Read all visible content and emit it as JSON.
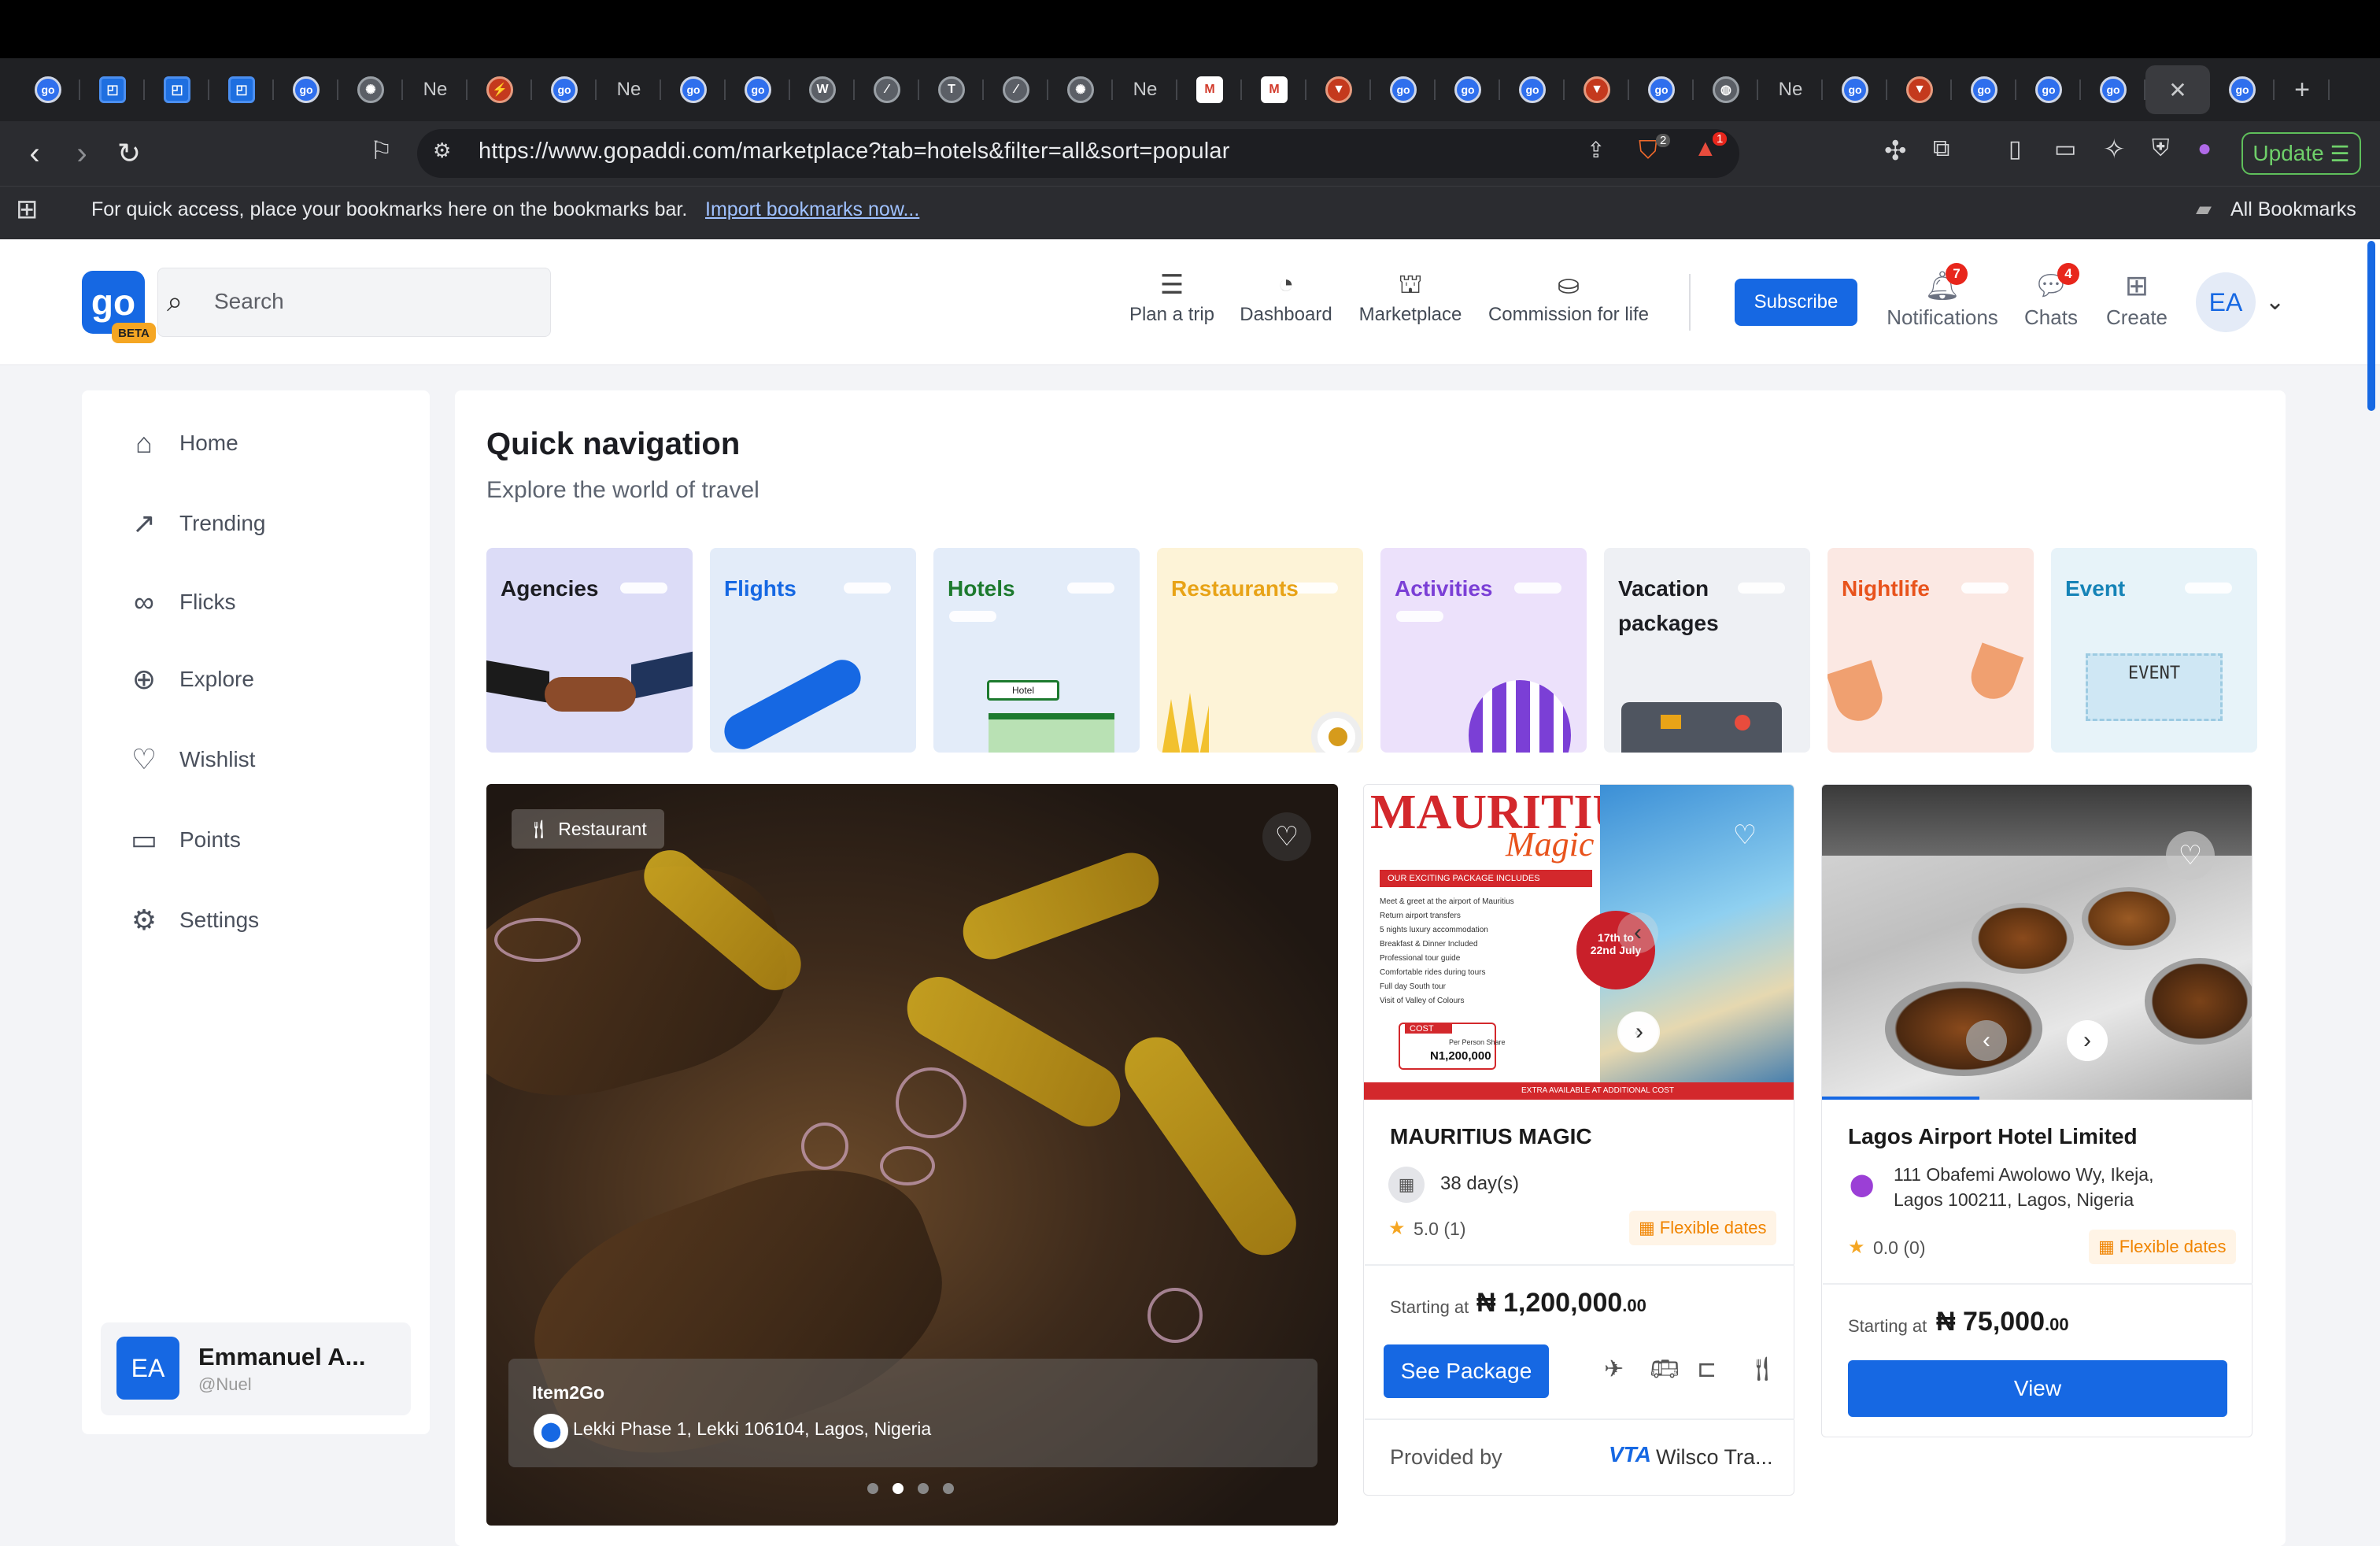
{
  "browser": {
    "tabs": [
      {
        "icon": "go",
        "label": ""
      },
      {
        "icon": "ms",
        "label": ""
      },
      {
        "icon": "ms",
        "label": ""
      },
      {
        "icon": "ms",
        "label": ""
      },
      {
        "icon": "go",
        "label": ""
      },
      {
        "icon": "openai",
        "label": ""
      },
      {
        "icon": "text",
        "label": "Ne"
      },
      {
        "icon": "bolt",
        "label": ""
      },
      {
        "icon": "go",
        "label": ""
      },
      {
        "icon": "text",
        "label": "Ne"
      },
      {
        "icon": "go",
        "label": ""
      },
      {
        "icon": "go",
        "label": ""
      },
      {
        "icon": "wp",
        "label": ""
      },
      {
        "icon": "slash",
        "label": ""
      },
      {
        "icon": "t",
        "label": ""
      },
      {
        "icon": "slash",
        "label": ""
      },
      {
        "icon": "openai",
        "label": ""
      },
      {
        "icon": "text",
        "label": "Ne"
      },
      {
        "icon": "gmail",
        "label": ""
      },
      {
        "icon": "gmail",
        "label": ""
      },
      {
        "icon": "brave",
        "label": ""
      },
      {
        "icon": "go",
        "label": ""
      },
      {
        "icon": "go",
        "label": ""
      },
      {
        "icon": "go",
        "label": ""
      },
      {
        "icon": "brave",
        "label": ""
      },
      {
        "icon": "go",
        "label": ""
      },
      {
        "icon": "globe",
        "label": ""
      },
      {
        "icon": "text",
        "label": "Ne"
      },
      {
        "icon": "go",
        "label": ""
      },
      {
        "icon": "brave",
        "label": ""
      },
      {
        "icon": "go",
        "label": ""
      },
      {
        "icon": "go",
        "label": ""
      },
      {
        "icon": "go",
        "label": ""
      },
      {
        "icon": "close",
        "label": "✕"
      },
      {
        "icon": "go",
        "label": ""
      }
    ],
    "new_tab": "+",
    "url": "https://www.gopaddi.com/marketplace?tab=hotels&filter=all&sort=popular",
    "brave_badge": "2",
    "alert_badge": "1",
    "update_label": "Update",
    "bookmarks_hint": "For quick access, place your bookmarks here on the bookmarks bar.",
    "bookmarks_link": "Import bookmarks now...",
    "all_bookmarks": "All Bookmarks"
  },
  "header": {
    "logo": "go",
    "beta": "BETA",
    "search_placeholder": "Search",
    "nav": [
      {
        "label": "Plan a trip",
        "icon": "checklist-icon"
      },
      {
        "label": "Dashboard",
        "icon": "pie-chart-icon"
      },
      {
        "label": "Marketplace",
        "icon": "store-icon"
      },
      {
        "label": "Commission for life",
        "icon": "hand-coins-icon"
      }
    ],
    "subscribe": "Subscribe",
    "notifications": {
      "label": "Notifications",
      "count": "7"
    },
    "chats": {
      "label": "Chats",
      "count": "4"
    },
    "create": "Create",
    "avatar": "EA"
  },
  "sidebar": {
    "items": [
      {
        "label": "Home",
        "icon": "home-icon"
      },
      {
        "label": "Trending",
        "icon": "trending-icon"
      },
      {
        "label": "Flicks",
        "icon": "reel-icon"
      },
      {
        "label": "Explore",
        "icon": "globe-icon"
      },
      {
        "label": "Wishlist",
        "icon": "heart-icon"
      },
      {
        "label": "Points",
        "icon": "wallet-icon"
      },
      {
        "label": "Settings",
        "icon": "gear-icon"
      }
    ],
    "user": {
      "initials": "EA",
      "name": "Emmanuel A...",
      "handle": "@Nuel"
    }
  },
  "quick_nav": {
    "title": "Quick navigation",
    "subtitle": "Explore the world of travel",
    "tiles": [
      {
        "label": "Agencies",
        "bg": "#dcdcf7",
        "color": "#1c1d22"
      },
      {
        "label": "Flights",
        "bg": "#e3ecf9",
        "color": "#1668e3"
      },
      {
        "label": "Hotels",
        "bg": "#e3ecf9",
        "color": "#1d7a2e"
      },
      {
        "label": "Restaurants",
        "bg": "#fdf3d7",
        "color": "#e8a317"
      },
      {
        "label": "Activities",
        "bg": "#ece1fb",
        "color": "#7b3fd6"
      },
      {
        "label": "Vacation packages",
        "bg": "#eef0f4",
        "color": "#1c1d22"
      },
      {
        "label": "Nightlife",
        "bg": "#fbe8e3",
        "color": "#e8531c"
      },
      {
        "label": "Event",
        "bg": "#e7f3f9",
        "color": "#1583b7"
      }
    ],
    "event_ticket": "EVENT",
    "hotel_sign": "Hotel"
  },
  "featured": {
    "category": "Restaurant",
    "name": "Item2Go",
    "location": "Lekki Phase 1, Lekki 106104, Lagos, Nigeria",
    "slide_count": 4,
    "active_slide": 2
  },
  "package_card": {
    "poster_title": "MAURITIUS",
    "poster_subtitle": "Magic",
    "poster_banner": "OUR EXCITING PACKAGE INCLUDES",
    "poster_items": [
      "Meet & greet at the airport of Mauritius",
      "Return airport transfers",
      "5 nights luxury accommodation",
      "Breakfast & Dinner Included",
      "Professional tour guide",
      "Comfortable rides during tours",
      "Full day South tour",
      "Visit of Valley of Colours"
    ],
    "poster_dates": "17th to 22nd July",
    "poster_cost_label": "COST",
    "poster_cost_sub": "Per Person Share",
    "poster_cost_value": "N1,200,000",
    "poster_footer": "EXTRA AVAILABLE AT ADDITIONAL COST",
    "title": "MAURITIUS MAGIC",
    "duration": "38 day(s)",
    "rating": "5.0 (1)",
    "flexible": "Flexible dates",
    "starting_at": "Starting at",
    "price": "₦ 1,200,000",
    "price_decimals": ".00",
    "button": "See Package",
    "provided_by": "Provided by",
    "provider": "Wilsco Tra...",
    "provider_logo": "VTA"
  },
  "hotel_card": {
    "title": "Lagos Airport Hotel Limited",
    "address": "111 Obafemi Awolowo Wy, Ikeja, Lagos 100211, Lagos, Nigeria",
    "rating": "0.0 (0)",
    "flexible": "Flexible dates",
    "starting_at": "Starting at",
    "price": "₦ 75,000",
    "price_decimals": ".00",
    "button": "View"
  }
}
